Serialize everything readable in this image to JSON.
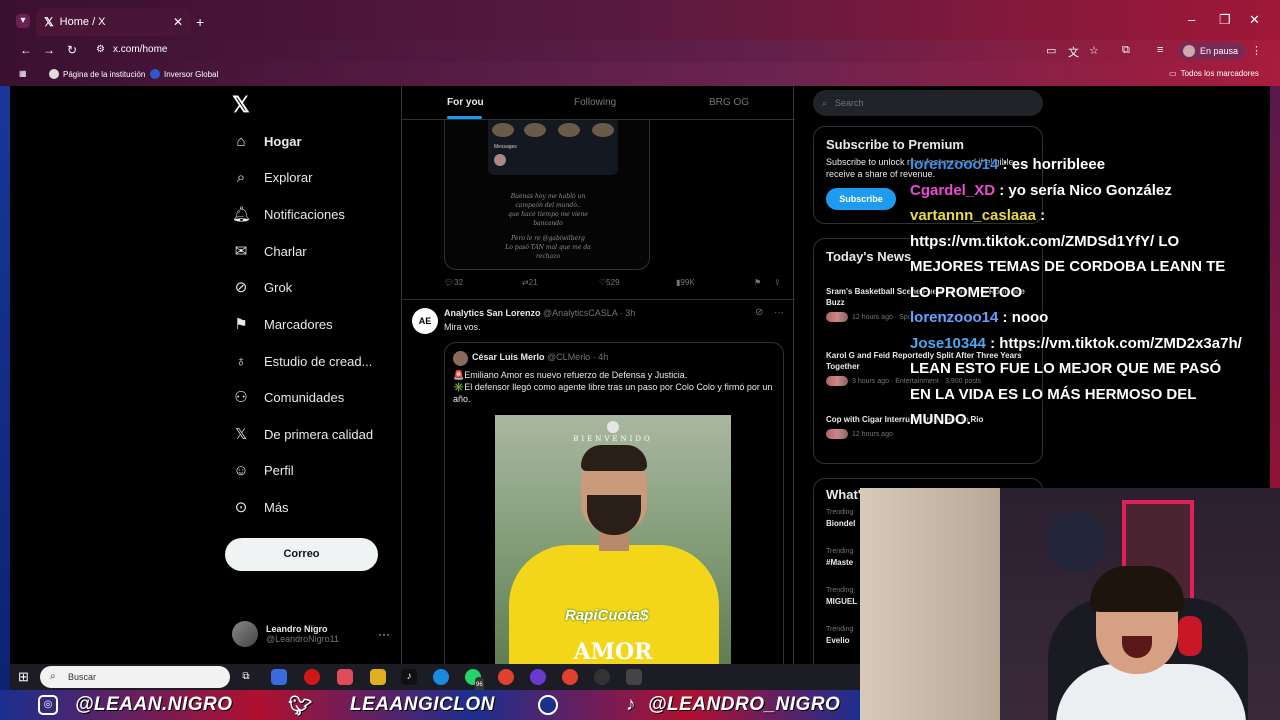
{
  "browser": {
    "tab_title": "Home / X",
    "url": "x.com/home",
    "profile_status": "En pausa",
    "bookmarks": [
      "Página de la institución",
      "Inversor Global"
    ],
    "all_bookmarks": "Todos los marcadores"
  },
  "sidebar": {
    "items": [
      {
        "label": "Hogar",
        "icon": "home-icon"
      },
      {
        "label": "Explorar",
        "icon": "search-icon"
      },
      {
        "label": "Notificaciones",
        "icon": "bell-icon"
      },
      {
        "label": "Charlar",
        "icon": "mail-icon"
      },
      {
        "label": "Grok",
        "icon": "grok-icon"
      },
      {
        "label": "Marcadores",
        "icon": "bookmark-icon"
      },
      {
        "label": "Estudio de cread...",
        "icon": "studio-icon"
      },
      {
        "label": "Comunidades",
        "icon": "communities-icon"
      },
      {
        "label": "De primera calidad",
        "icon": "x-icon"
      },
      {
        "label": "Perfil",
        "icon": "person-icon"
      },
      {
        "label": "Más",
        "icon": "more-icon"
      }
    ],
    "post_button": "Correo",
    "user": {
      "name": "Leandro Nigro",
      "handle": "@LeandroNigro11"
    }
  },
  "feed": {
    "tabs": [
      "For you",
      "Following",
      "BRG OG"
    ],
    "image_tweet": {
      "image_messages_label": "Messages",
      "poem": [
        "Buenas hoy me habló un",
        "campeón del mundo..",
        "que hace tiempo me viene",
        "bancando",
        "",
        "Pero le re @gabiwilberg",
        "Lo pasó TAN mal que me da",
        "rechazo"
      ],
      "replies": "32",
      "retweets": "21",
      "likes": "529",
      "views": "99K"
    },
    "tweet": {
      "author": "Analytics San Lorenzo",
      "handle": "@AnalyticsCASLA",
      "time": "3h",
      "text": "Mira vos.",
      "quote": {
        "author": "César Luis Merlo",
        "handle": "@CLMerlo",
        "time": "4h",
        "line1": "🚨Emiliano Amor es nuevo refuerzo de Defensa y Justicia.",
        "line2": "✳️El defensor llegó como agente libre tras un paso por Colo Colo y firmó por un año.",
        "poster_header": "BIENVENIDO",
        "poster_sponsor": "RapiCuota$",
        "poster_name": "AMOR"
      }
    }
  },
  "right": {
    "search_placeholder": "Search",
    "premium": {
      "title": "Subscribe to Premium",
      "text": "Subscribe to unlock new features and if eligible, receive a share of revenue.",
      "button": "Subscribe"
    },
    "news": {
      "title": "Today's News",
      "items": [
        {
          "title": "Sram's Basketball Scene Fuels Lovro-Ivan Romance Buzz",
          "meta": "12 hours ago · Sports · 4,683 posts"
        },
        {
          "title": "Karol G and Feid Reportedly Split After Three Years Together",
          "meta": "3 hours ago · Entertainment · 3,900 posts"
        },
        {
          "title": "Cop with Cigar Interrupts Interview in Rio",
          "meta": "12 hours ago"
        }
      ]
    },
    "trending": {
      "title": "What's happening",
      "items": [
        {
          "label": "Trending",
          "value": "Biondel"
        },
        {
          "label": "Trending",
          "value": "#Maste"
        },
        {
          "label": "Trending",
          "value": "MIGUEL"
        },
        {
          "label": "Trending",
          "value": "Evelio"
        }
      ]
    }
  },
  "chat": [
    {
      "user": "lorenzooo14",
      "msg": ": es horribleee"
    },
    {
      "user": "Cgardel_XD",
      "msg": ": yo sería Nico González"
    },
    {
      "user": "vartannn_caslaaa",
      "msg": ": https://vm.tiktok.com/ZMDSd1YfY/ LO MEJORES TEMAS DE CORDOBA LEANN TE LO PROMETOO"
    },
    {
      "user": "lorenzooo14",
      "msg": ": nooo"
    },
    {
      "user": "Jose10344",
      "msg": ": https://vm.tiktok.com/ZMD2x3a7h/ LEAN ESTO FUE LO MEJOR QUE ME PASÓ EN LA VIDA ES LO MÁS HERMOSO DEL MUNDO."
    }
  ],
  "taskbar": {
    "search_placeholder": "Buscar",
    "whatsapp_badge": "96"
  },
  "banner": {
    "instagram": "@LEAAN.NIGRO",
    "twitter": "LEAANGICLON",
    "tiktok": "@LEANDRO_NIGRO"
  }
}
